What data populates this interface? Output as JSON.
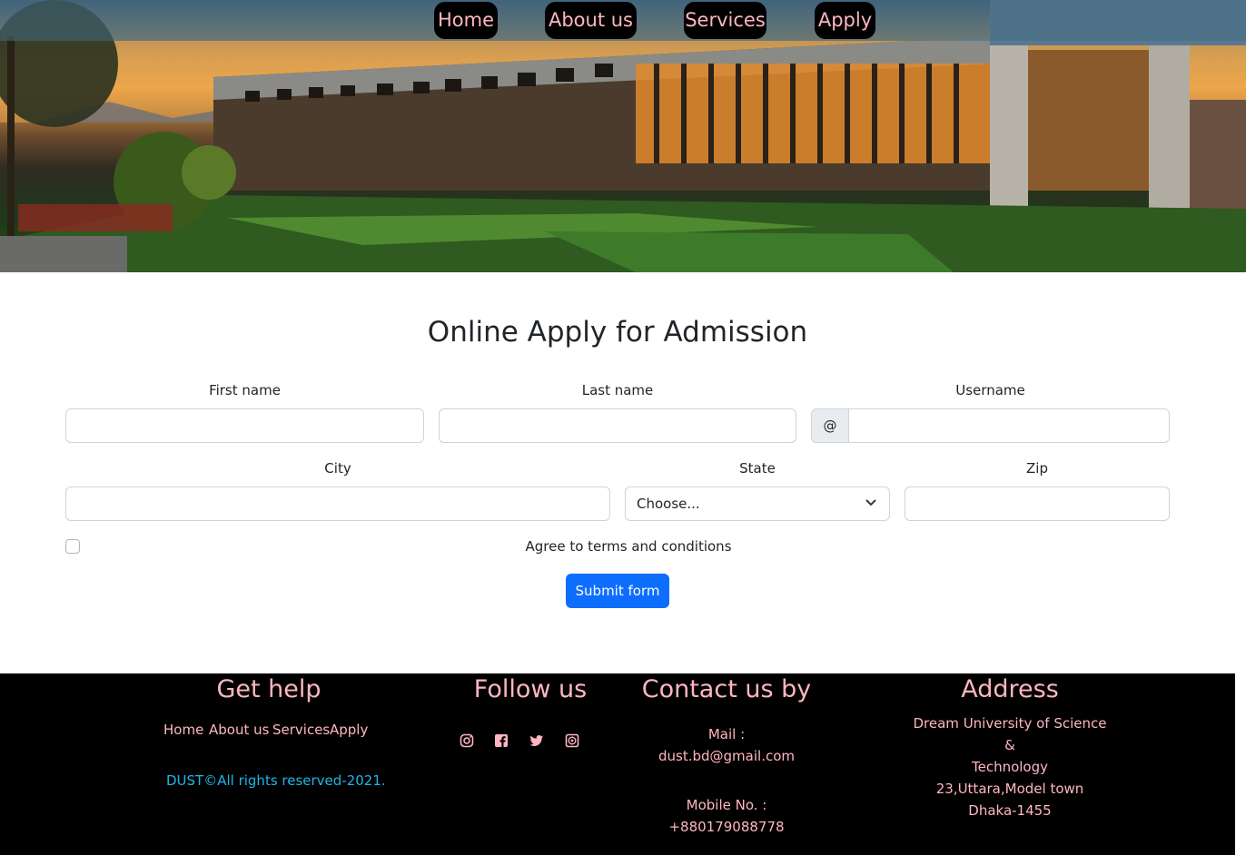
{
  "nav": {
    "home": "Home",
    "about": "About us",
    "services": "Services",
    "apply": "Apply"
  },
  "form": {
    "title": "Online Apply for Admission",
    "first_name_label": "First name",
    "last_name_label": "Last name",
    "username_label": "Username",
    "username_prefix": "@",
    "city_label": "City",
    "state_label": "State",
    "state_selected": "Choose...",
    "zip_label": "Zip",
    "agree_label": "Agree to terms and conditions",
    "submit_label": "Submit form"
  },
  "footer": {
    "help_heading": "Get help",
    "help_links": [
      "Home",
      "About us",
      "Services",
      "Apply"
    ],
    "copyright": "DUST©All rights reserved-2021.",
    "follow_heading": "Follow us",
    "social_icons": [
      "instagram-icon",
      "facebook-icon",
      "twitter-icon",
      "whatsapp-icon"
    ],
    "contact_heading": "Contact us by",
    "mail_label": "Mail :",
    "mail_value": "dust.bd@gmail.com",
    "mobile_label": "Mobile No. :",
    "mobile_value": "+880179088778",
    "address_heading": "Address",
    "address_lines": [
      "Dream University of Science",
      "&",
      "Technology",
      "23,Uttara,Model town",
      "Dhaka-1455"
    ]
  },
  "colors": {
    "accent_pink": "#ffb6c1",
    "button_blue": "#0d6efd",
    "copyright_cyan": "#1fb6e6"
  }
}
